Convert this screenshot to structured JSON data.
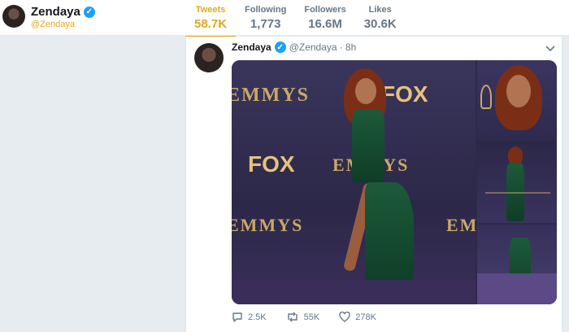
{
  "profile": {
    "name": "Zendaya",
    "handle": "@Zendaya"
  },
  "stats": [
    {
      "label": "Tweets",
      "value": "58.7K",
      "active": true
    },
    {
      "label": "Following",
      "value": "1,773"
    },
    {
      "label": "Followers",
      "value": "16.6M"
    },
    {
      "label": "Likes",
      "value": "30.6K"
    }
  ],
  "tweet": {
    "name": "Zendaya",
    "handle": "@Zendaya",
    "time": "· 8h",
    "media": {
      "backdrop_texts": [
        "EMMYS",
        "FOX",
        "EMMYS",
        "EMMYS",
        "FOX",
        "EMMYS"
      ]
    },
    "actions": {
      "replies": "2.5K",
      "retweets": "55K",
      "likes": "278K"
    }
  },
  "colors": {
    "accent": "#e0a820",
    "verified": "#1da1f2",
    "muted": "#657786"
  },
  "icons": {
    "verified": "verified-badge-icon",
    "chevron": "chevron-down-icon",
    "reply": "reply-icon",
    "retweet": "retweet-icon",
    "like": "heart-icon"
  }
}
